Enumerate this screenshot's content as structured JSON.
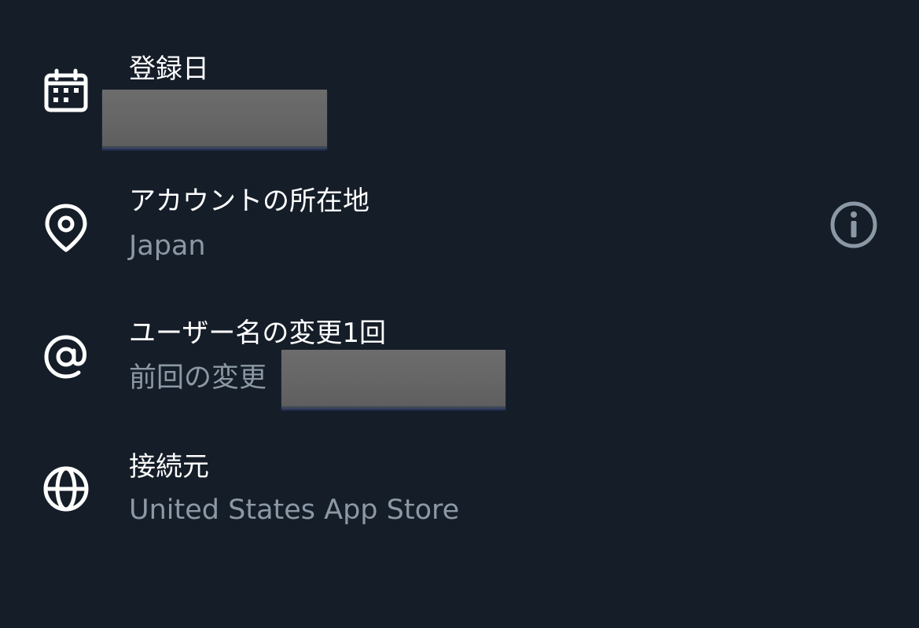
{
  "rows": [
    {
      "id": "registration-date",
      "icon": "calendar-icon",
      "label": "登録日",
      "value": "",
      "value_redacted": true
    },
    {
      "id": "account-location",
      "icon": "location-pin-icon",
      "label": "アカウントの所在地",
      "value": "Japan",
      "trailing_icon": "info-icon"
    },
    {
      "id": "username-changes",
      "icon": "at-sign-icon",
      "label": "ユーザー名の変更1回",
      "value": "前回の変更",
      "value_redacted": true
    },
    {
      "id": "connected-from",
      "icon": "globe-icon",
      "label": "接続元",
      "value": "United States App Store"
    }
  ],
  "colors": {
    "background": "#151d28",
    "label": "#ffffff",
    "secondary": "#8b98a5",
    "redaction": "#666666"
  }
}
